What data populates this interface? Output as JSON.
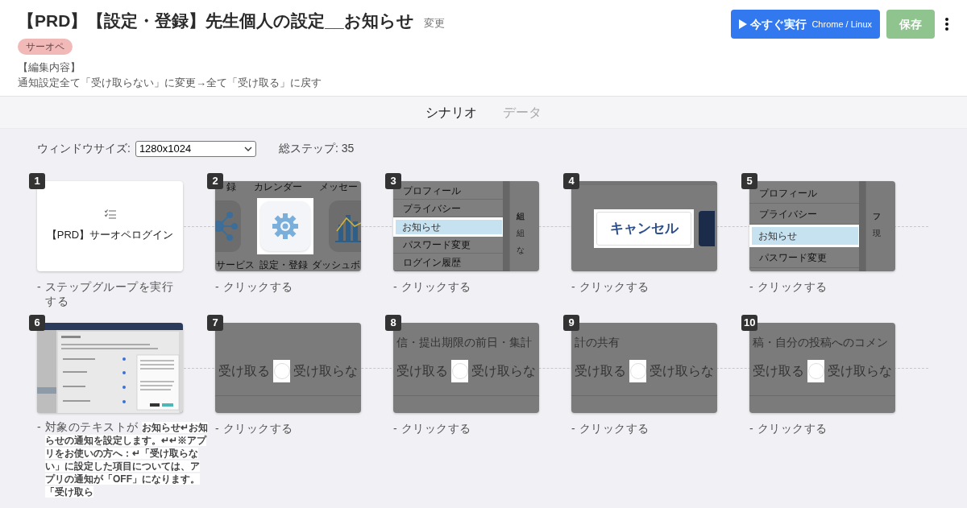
{
  "header": {
    "title": "【PRD】【設定・登録】先生個人の設定__お知らせ",
    "rename_link": "変更",
    "tag": "サーオペ",
    "notes_heading": "【編集内容】",
    "notes": "通知設定全て「受け取らない」に変更→全て「受け取る」に戻す"
  },
  "actions": {
    "run_button": "今すぐ実行",
    "run_target": "Chrome / Linux",
    "save_button": "保存",
    "save_disabled": true
  },
  "tabs": [
    {
      "label": "シナリオ",
      "selected": true
    },
    {
      "label": "データ",
      "selected": false
    }
  ],
  "toolbar": {
    "window_size_label": "ウィンドウサイズ:",
    "window_size": "1280x1024",
    "total_steps": "総ステップ: 35"
  },
  "steps": [
    {
      "number": "1",
      "kind": "group",
      "title": "【PRD】サーオペログイン",
      "description": "- ステップグループを実行する"
    },
    {
      "number": "2",
      "kind": "icons",
      "top_labels": [
        "録",
        "カレンダー",
        "メッセー"
      ],
      "bottom_labels": [
        "サービス",
        "設定・登録",
        "ダッシュボ"
      ],
      "description": "- クリックする"
    },
    {
      "number": "3",
      "kind": "menu",
      "items": [
        {
          "label": "プロフィール",
          "selected": false
        },
        {
          "label": "プライバシー",
          "selected": false
        },
        {
          "label": "お知らせ",
          "selected": true
        },
        {
          "label": "パスワード変更",
          "selected": false
        },
        {
          "label": "ログイン履歴",
          "selected": false
        }
      ],
      "side_texts": [
        "組",
        "組",
        "な"
      ],
      "description": "- クリックする"
    },
    {
      "number": "4",
      "kind": "button",
      "button_label": "キャンセル",
      "description": "- クリックする"
    },
    {
      "number": "5",
      "kind": "menu",
      "items": [
        {
          "label": "プロフィール",
          "selected": false
        },
        {
          "label": "プライバシー",
          "selected": false
        },
        {
          "label": "お知らせ",
          "selected": true
        },
        {
          "label": "パスワード変更",
          "selected": false
        }
      ],
      "side_texts": [
        "フ",
        "現"
      ],
      "description": "- クリックする"
    },
    {
      "number": "6",
      "kind": "page",
      "description": "- 対象のテキストが",
      "quote": "お知らせ↵お知らせの通知を設定します。↵↵※アプリをお使いの方へ：↵「受け取らない」に設定した項目については、アプリの通知が「OFF」になります。「受け取ら"
    },
    {
      "number": "7",
      "kind": "radio",
      "option_on": "受け取る",
      "checked": false,
      "option_off": "受け取らな",
      "description": "- クリックする"
    },
    {
      "number": "8",
      "kind": "radio",
      "heading": "信・提出期限の前日・集計",
      "option_on": "受け取る",
      "checked": false,
      "option_off": "受け取らな",
      "description": "- クリックする"
    },
    {
      "number": "9",
      "kind": "radio",
      "heading": "計の共有",
      "option_on": "受け取る",
      "checked": false,
      "option_off": "受け取らな",
      "description": "- クリックする"
    },
    {
      "number": "10",
      "kind": "radio",
      "heading": "稿・自分の投稿へのコメン",
      "option_on": "受け取る",
      "checked": false,
      "option_off": "受け取らな",
      "description": "- クリックする"
    }
  ]
}
